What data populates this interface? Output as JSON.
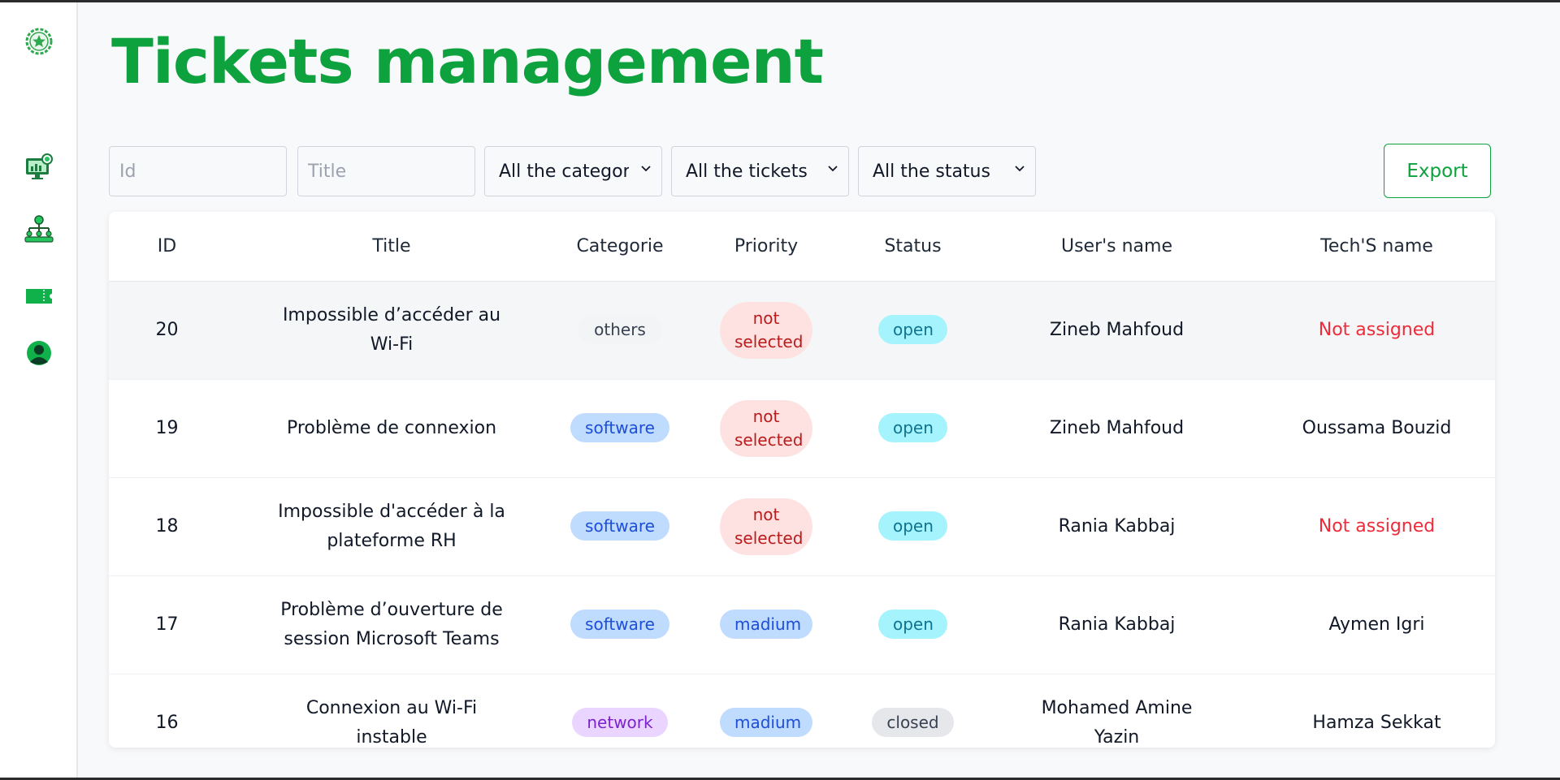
{
  "sidebar": {
    "logo_icon": "green-star-emblem-icon",
    "items": [
      {
        "icon": "monitor-chart-icon"
      },
      {
        "icon": "team-hierarchy-icon"
      },
      {
        "icon": "ticket-icon"
      },
      {
        "icon": "user-avatar-icon"
      }
    ]
  },
  "page": {
    "title": "Tickets management",
    "accent_color": "#0da23d"
  },
  "filters": {
    "id_placeholder": "Id",
    "title_placeholder": "Title",
    "category_value": "All the categories",
    "tickets_value": "All the tickets",
    "status_value": "All the status"
  },
  "export_label": "Export",
  "table": {
    "headers": [
      "ID",
      "Title",
      "Categorie",
      "Priority",
      "Status",
      "User's name",
      "Tech'S name"
    ],
    "rows": [
      {
        "id": "20",
        "title": "Impossible d’accéder au Wi-Fi",
        "category": "others",
        "priority": "not selected",
        "status": "open",
        "user": "Zineb Mahfoud",
        "tech": "Not assigned"
      },
      {
        "id": "19",
        "title": "Problème de connexion",
        "category": "software",
        "priority": "not selected",
        "status": "open",
        "user": "Zineb Mahfoud",
        "tech": "Oussama Bouzid"
      },
      {
        "id": "18",
        "title": "Impossible d'accéder à la plateforme RH",
        "category": "software",
        "priority": "not selected",
        "status": "open",
        "user": "Rania Kabbaj",
        "tech": "Not assigned"
      },
      {
        "id": "17",
        "title": "Problème d’ouverture de session Microsoft Teams",
        "category": "software",
        "priority": "madium",
        "status": "open",
        "user": "Rania Kabbaj",
        "tech": "Aymen Igri"
      },
      {
        "id": "16",
        "title": "Connexion au Wi-Fi instable",
        "category": "network",
        "priority": "madium",
        "status": "closed",
        "user": "Mohamed Amine Yazin",
        "tech": "Hamza Sekkat"
      }
    ]
  }
}
